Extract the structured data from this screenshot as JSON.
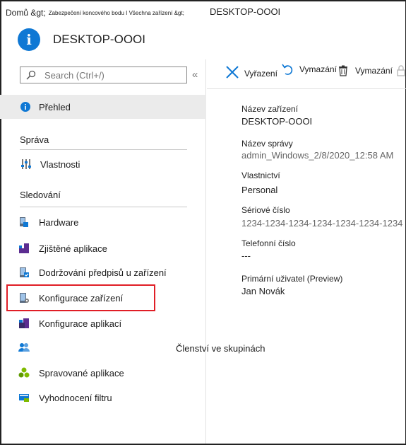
{
  "breadcrumb": {
    "home": "Domů &gt;",
    "middle": "Zabezpečení koncového bodu I Všechna zařízení &gt;",
    "current": "DESKTOP-OOOI"
  },
  "header": {
    "title": "DESKTOP-OOOI",
    "icon": "info-icon"
  },
  "search": {
    "placeholder": "Search (Ctrl+/)"
  },
  "collapse_glyph": "«",
  "nav": {
    "overview": "Přehled",
    "section_manage": "Správa",
    "properties": "Vlastnosti",
    "section_monitor": "Sledování",
    "hardware": "Hardware",
    "discovered_apps": "Zjištěné aplikace",
    "compliance": "Dodržování předpisů u zařízení",
    "device_config": "Konfigurace zařízení",
    "app_config": "Konfigurace aplikací",
    "managed_apps": "Spravované aplikace",
    "filter_eval": "Vyhodnocení filtru"
  },
  "group_membership": "Členství ve skupinách",
  "toolbar": {
    "retire": "Vyřazení",
    "wipe": "Vymazání",
    "delete": "Vymazání"
  },
  "details": {
    "device_name_label": "Název zařízení",
    "device_name_value": "DESKTOP-OOOI",
    "mgmt_name_label": "Název správy",
    "mgmt_name_value": "admin_Windows_2/8/2020_12:58 AM",
    "ownership_label": "Vlastnictví",
    "ownership_value": "Personal",
    "serial_label": "Sériové číslo",
    "serial_value": "1234-1234-1234-1234-1234-1234-1234",
    "phone_label": "Telefonní číslo",
    "phone_value": "---",
    "primary_user_label": "Primární uživatel (Preview)",
    "primary_user_value": "Jan Novák"
  },
  "colors": {
    "accent": "#0f78d4",
    "highlight": "#e01e26"
  }
}
